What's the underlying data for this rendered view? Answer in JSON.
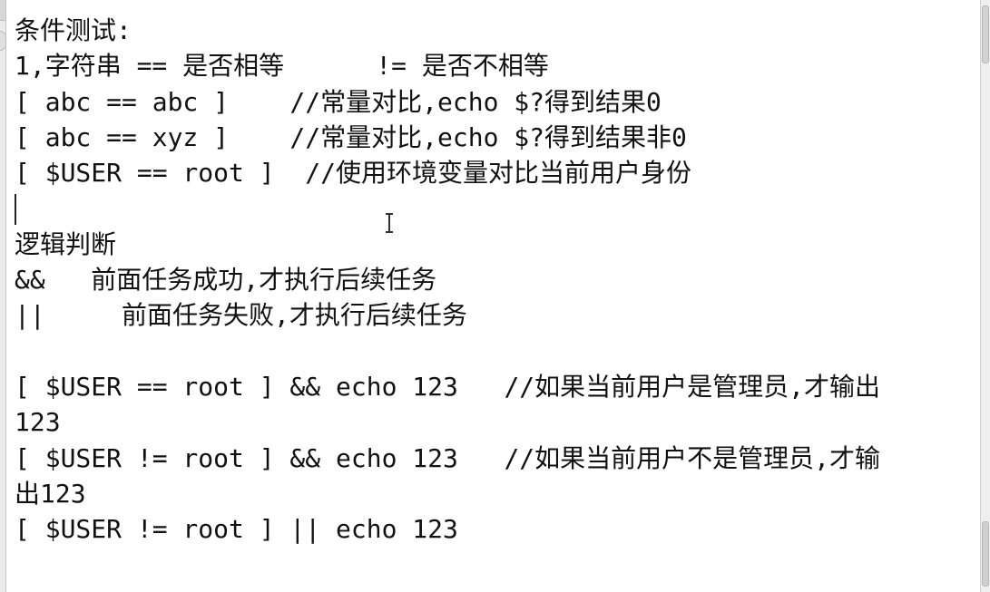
{
  "editor": {
    "lines": [
      "条件测试:",
      "1,字符串 == 是否相等      != 是否不相等",
      "[ abc == abc ]    //常量对比,echo $?得到结果0",
      "[ abc == xyz ]    //常量对比,echo $?得到结果非0",
      "[ $USER == root ]  //使用环境变量对比当前用户身份",
      "",
      "逻辑判断",
      "&&   前面任务成功,才执行后续任务",
      "||     前面任务失败,才执行后续任务",
      "",
      "[ $USER == root ] && echo 123   //如果当前用户是管理员,才输出",
      "123",
      "[ $USER != root ] && echo 123   //如果当前用户不是管理员,才输",
      "出123",
      "[ $USER != root ] || echo 123"
    ]
  }
}
